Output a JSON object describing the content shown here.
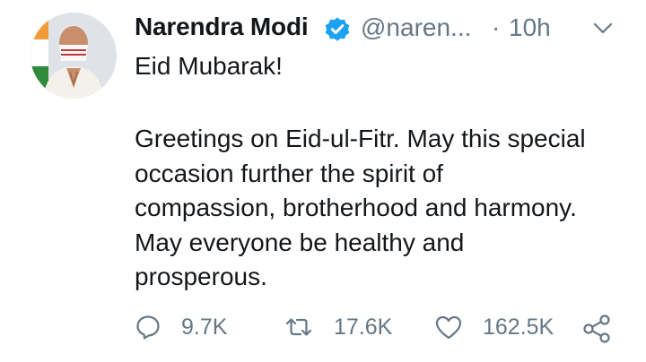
{
  "tweet": {
    "author_name": "Narendra Modi",
    "handle": "@naren...",
    "separator": "·",
    "time": "10h",
    "avatar_icon": "profile-photo",
    "text_line_1": "Eid Mubarak!",
    "body_lines": [
      "Greetings on Eid-ul-Fitr. May this special",
      "occasion further the spirit of",
      "compassion, brotherhood and harmony.",
      "May everyone be healthy and",
      "prosperous."
    ]
  },
  "actions": {
    "reply_count": "9.7K",
    "retweet_count": "17.6K",
    "like_count": "162.5K"
  },
  "colors": {
    "verified_badge": "#1da1f2",
    "secondary_text": "#657786",
    "primary_text": "#14171a"
  }
}
